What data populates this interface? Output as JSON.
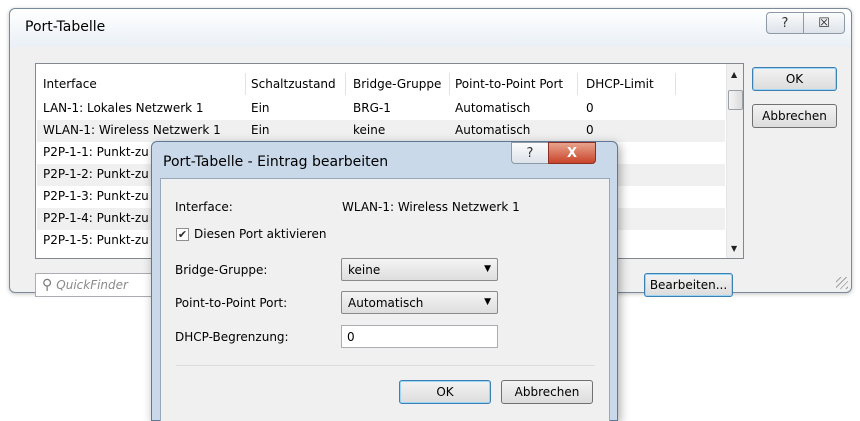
{
  "main_window": {
    "title": "Port-Tabelle",
    "help_glyph": "?",
    "close_glyph": "☒",
    "table": {
      "columns": [
        "Interface",
        "Schaltzustand",
        "Bridge-Gruppe",
        "Point-to-Point Port",
        "DHCP-Limit"
      ],
      "rows": [
        {
          "interface": "LAN-1: Lokales Netzwerk 1",
          "schaltzustand": "Ein",
          "bridge": "BRG-1",
          "p2p": "Automatisch",
          "dhcp": "0"
        },
        {
          "interface": "WLAN-1: Wireless Netzwerk 1",
          "schaltzustand": "Ein",
          "bridge": "keine",
          "p2p": "Automatisch",
          "dhcp": "0"
        },
        {
          "interface": "P2P-1-1: Punkt-zu"
        },
        {
          "interface": "P2P-1-2: Punkt-zu"
        },
        {
          "interface": "P2P-1-3: Punkt-zu"
        },
        {
          "interface": "P2P-1-4: Punkt-zu"
        },
        {
          "interface": "P2P-1-5: Punkt-zu"
        }
      ]
    },
    "ok_label": "OK",
    "cancel_label": "Abbrechen",
    "edit_label": "Bearbeiten...",
    "quickfinder_placeholder": "QuickFinder"
  },
  "dialog": {
    "title": "Port-Tabelle - Eintrag bearbeiten",
    "help_glyph": "?",
    "close_glyph": "X",
    "interface_label": "Interface:",
    "interface_value": "WLAN-1: Wireless Netzwerk 1",
    "activate_label": "Diesen Port aktivieren",
    "activate_checked": true,
    "bridge_label": "Bridge-Gruppe:",
    "bridge_value": "keine",
    "p2p_label": "Point-to-Point Port:",
    "p2p_value": "Automatisch",
    "dhcp_label": "DHCP-Begrenzung:",
    "dhcp_value": "0",
    "ok_label": "OK",
    "cancel_label": "Abbrechen"
  }
}
